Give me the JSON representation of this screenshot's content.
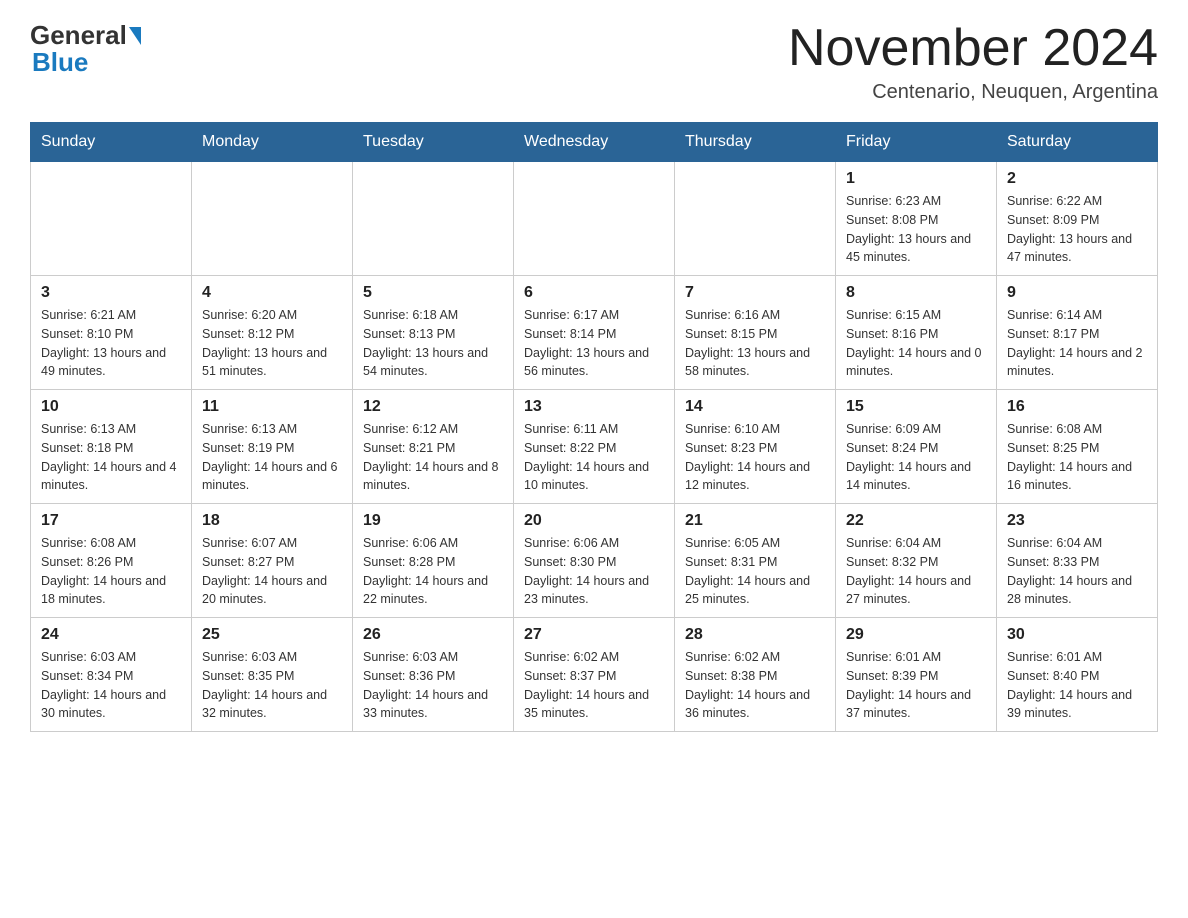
{
  "header": {
    "logo_general": "General",
    "logo_blue": "Blue",
    "month_title": "November 2024",
    "location": "Centenario, Neuquen, Argentina"
  },
  "calendar": {
    "days_of_week": [
      "Sunday",
      "Monday",
      "Tuesday",
      "Wednesday",
      "Thursday",
      "Friday",
      "Saturday"
    ],
    "weeks": [
      [
        {
          "day": "",
          "sunrise": "",
          "sunset": "",
          "daylight": ""
        },
        {
          "day": "",
          "sunrise": "",
          "sunset": "",
          "daylight": ""
        },
        {
          "day": "",
          "sunrise": "",
          "sunset": "",
          "daylight": ""
        },
        {
          "day": "",
          "sunrise": "",
          "sunset": "",
          "daylight": ""
        },
        {
          "day": "",
          "sunrise": "",
          "sunset": "",
          "daylight": ""
        },
        {
          "day": "1",
          "sunrise": "Sunrise: 6:23 AM",
          "sunset": "Sunset: 8:08 PM",
          "daylight": "Daylight: 13 hours and 45 minutes."
        },
        {
          "day": "2",
          "sunrise": "Sunrise: 6:22 AM",
          "sunset": "Sunset: 8:09 PM",
          "daylight": "Daylight: 13 hours and 47 minutes."
        }
      ],
      [
        {
          "day": "3",
          "sunrise": "Sunrise: 6:21 AM",
          "sunset": "Sunset: 8:10 PM",
          "daylight": "Daylight: 13 hours and 49 minutes."
        },
        {
          "day": "4",
          "sunrise": "Sunrise: 6:20 AM",
          "sunset": "Sunset: 8:12 PM",
          "daylight": "Daylight: 13 hours and 51 minutes."
        },
        {
          "day": "5",
          "sunrise": "Sunrise: 6:18 AM",
          "sunset": "Sunset: 8:13 PM",
          "daylight": "Daylight: 13 hours and 54 minutes."
        },
        {
          "day": "6",
          "sunrise": "Sunrise: 6:17 AM",
          "sunset": "Sunset: 8:14 PM",
          "daylight": "Daylight: 13 hours and 56 minutes."
        },
        {
          "day": "7",
          "sunrise": "Sunrise: 6:16 AM",
          "sunset": "Sunset: 8:15 PM",
          "daylight": "Daylight: 13 hours and 58 minutes."
        },
        {
          "day": "8",
          "sunrise": "Sunrise: 6:15 AM",
          "sunset": "Sunset: 8:16 PM",
          "daylight": "Daylight: 14 hours and 0 minutes."
        },
        {
          "day": "9",
          "sunrise": "Sunrise: 6:14 AM",
          "sunset": "Sunset: 8:17 PM",
          "daylight": "Daylight: 14 hours and 2 minutes."
        }
      ],
      [
        {
          "day": "10",
          "sunrise": "Sunrise: 6:13 AM",
          "sunset": "Sunset: 8:18 PM",
          "daylight": "Daylight: 14 hours and 4 minutes."
        },
        {
          "day": "11",
          "sunrise": "Sunrise: 6:13 AM",
          "sunset": "Sunset: 8:19 PM",
          "daylight": "Daylight: 14 hours and 6 minutes."
        },
        {
          "day": "12",
          "sunrise": "Sunrise: 6:12 AM",
          "sunset": "Sunset: 8:21 PM",
          "daylight": "Daylight: 14 hours and 8 minutes."
        },
        {
          "day": "13",
          "sunrise": "Sunrise: 6:11 AM",
          "sunset": "Sunset: 8:22 PM",
          "daylight": "Daylight: 14 hours and 10 minutes."
        },
        {
          "day": "14",
          "sunrise": "Sunrise: 6:10 AM",
          "sunset": "Sunset: 8:23 PM",
          "daylight": "Daylight: 14 hours and 12 minutes."
        },
        {
          "day": "15",
          "sunrise": "Sunrise: 6:09 AM",
          "sunset": "Sunset: 8:24 PM",
          "daylight": "Daylight: 14 hours and 14 minutes."
        },
        {
          "day": "16",
          "sunrise": "Sunrise: 6:08 AM",
          "sunset": "Sunset: 8:25 PM",
          "daylight": "Daylight: 14 hours and 16 minutes."
        }
      ],
      [
        {
          "day": "17",
          "sunrise": "Sunrise: 6:08 AM",
          "sunset": "Sunset: 8:26 PM",
          "daylight": "Daylight: 14 hours and 18 minutes."
        },
        {
          "day": "18",
          "sunrise": "Sunrise: 6:07 AM",
          "sunset": "Sunset: 8:27 PM",
          "daylight": "Daylight: 14 hours and 20 minutes."
        },
        {
          "day": "19",
          "sunrise": "Sunrise: 6:06 AM",
          "sunset": "Sunset: 8:28 PM",
          "daylight": "Daylight: 14 hours and 22 minutes."
        },
        {
          "day": "20",
          "sunrise": "Sunrise: 6:06 AM",
          "sunset": "Sunset: 8:30 PM",
          "daylight": "Daylight: 14 hours and 23 minutes."
        },
        {
          "day": "21",
          "sunrise": "Sunrise: 6:05 AM",
          "sunset": "Sunset: 8:31 PM",
          "daylight": "Daylight: 14 hours and 25 minutes."
        },
        {
          "day": "22",
          "sunrise": "Sunrise: 6:04 AM",
          "sunset": "Sunset: 8:32 PM",
          "daylight": "Daylight: 14 hours and 27 minutes."
        },
        {
          "day": "23",
          "sunrise": "Sunrise: 6:04 AM",
          "sunset": "Sunset: 8:33 PM",
          "daylight": "Daylight: 14 hours and 28 minutes."
        }
      ],
      [
        {
          "day": "24",
          "sunrise": "Sunrise: 6:03 AM",
          "sunset": "Sunset: 8:34 PM",
          "daylight": "Daylight: 14 hours and 30 minutes."
        },
        {
          "day": "25",
          "sunrise": "Sunrise: 6:03 AM",
          "sunset": "Sunset: 8:35 PM",
          "daylight": "Daylight: 14 hours and 32 minutes."
        },
        {
          "day": "26",
          "sunrise": "Sunrise: 6:03 AM",
          "sunset": "Sunset: 8:36 PM",
          "daylight": "Daylight: 14 hours and 33 minutes."
        },
        {
          "day": "27",
          "sunrise": "Sunrise: 6:02 AM",
          "sunset": "Sunset: 8:37 PM",
          "daylight": "Daylight: 14 hours and 35 minutes."
        },
        {
          "day": "28",
          "sunrise": "Sunrise: 6:02 AM",
          "sunset": "Sunset: 8:38 PM",
          "daylight": "Daylight: 14 hours and 36 minutes."
        },
        {
          "day": "29",
          "sunrise": "Sunrise: 6:01 AM",
          "sunset": "Sunset: 8:39 PM",
          "daylight": "Daylight: 14 hours and 37 minutes."
        },
        {
          "day": "30",
          "sunrise": "Sunrise: 6:01 AM",
          "sunset": "Sunset: 8:40 PM",
          "daylight": "Daylight: 14 hours and 39 minutes."
        }
      ]
    ]
  }
}
